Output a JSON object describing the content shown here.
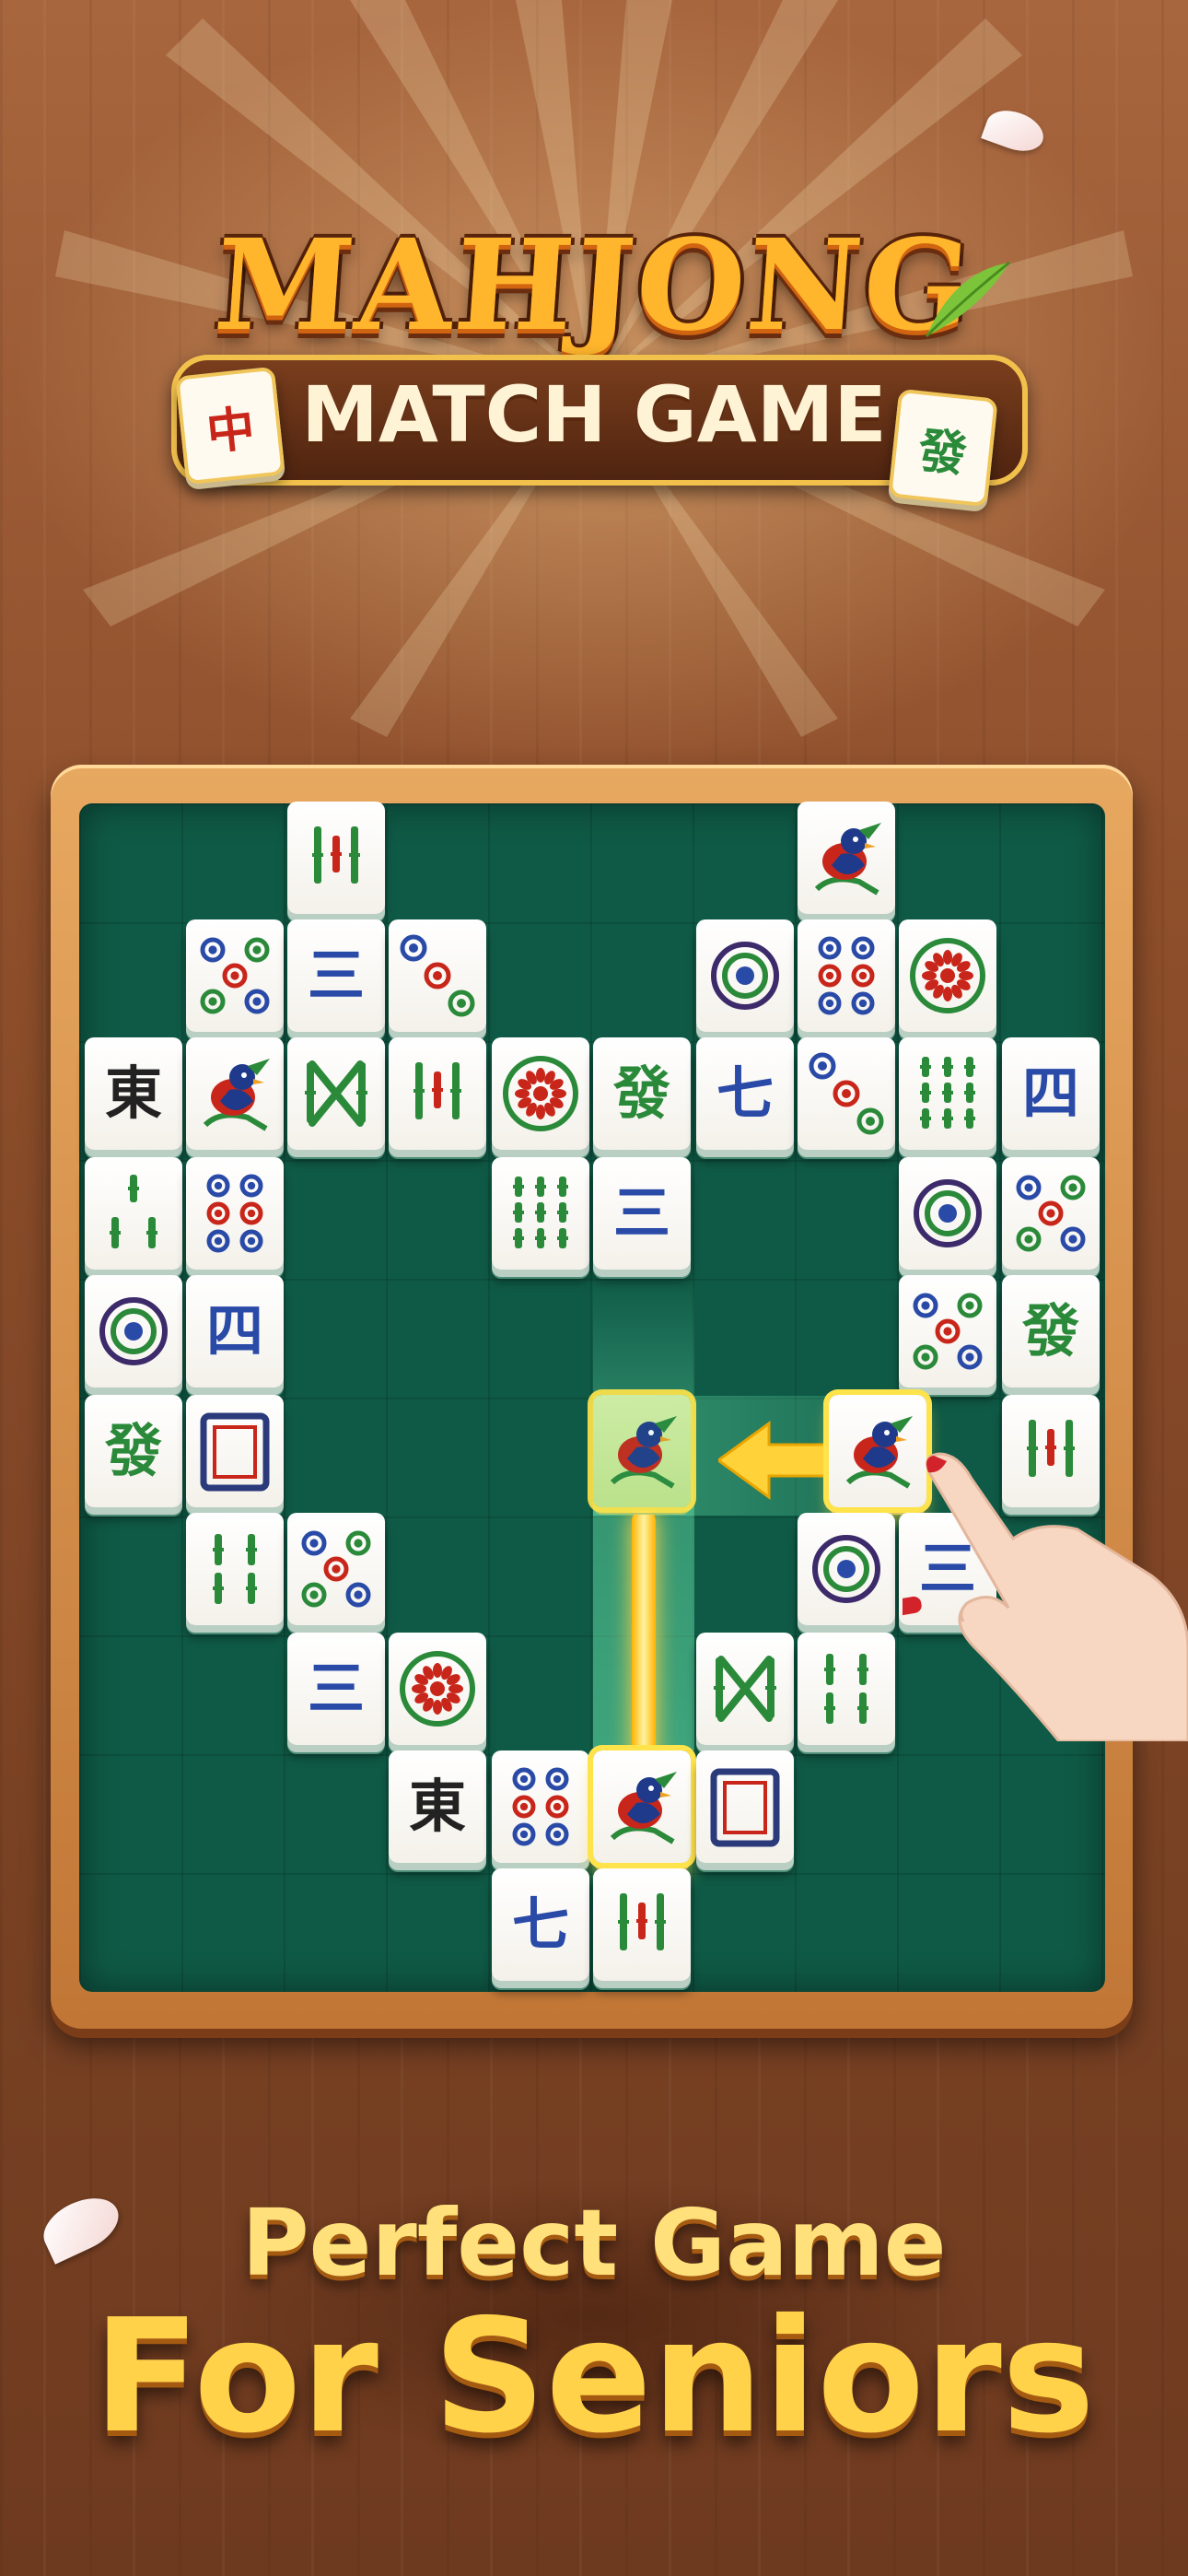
{
  "title": {
    "main": "MAHJONG",
    "sub": "MATCH GAME",
    "left_tile": "中",
    "right_tile": "發"
  },
  "colors": {
    "wood": "#8e4f2b",
    "felt": "#0f5a46",
    "frame": "#d68a45",
    "highlight": "#ffe34a",
    "tagline": "#ffd24a"
  },
  "tiles": [
    {
      "id": "t1",
      "kind": "bamboo3r"
    },
    {
      "id": "t2",
      "kind": "bird"
    },
    {
      "id": "t3",
      "kind": "circles5"
    },
    {
      "id": "t4",
      "kind": "char",
      "glyph": "三",
      "color": "blue"
    },
    {
      "id": "t5",
      "kind": "circles3"
    },
    {
      "id": "t6",
      "kind": "circle1"
    },
    {
      "id": "t7",
      "kind": "circles6"
    },
    {
      "id": "t8",
      "kind": "flower"
    },
    {
      "id": "t9",
      "kind": "char",
      "glyph": "東",
      "color": "black"
    },
    {
      "id": "t10",
      "kind": "bird"
    },
    {
      "id": "t11",
      "kind": "bamboo8"
    },
    {
      "id": "t12",
      "kind": "bamboo3r"
    },
    {
      "id": "t13",
      "kind": "flower"
    },
    {
      "id": "t14",
      "kind": "char",
      "glyph": "發",
      "color": "green"
    },
    {
      "id": "t15",
      "kind": "char",
      "glyph": "七",
      "color": "blue"
    },
    {
      "id": "t16",
      "kind": "circles3"
    },
    {
      "id": "t17",
      "kind": "bamboo9"
    },
    {
      "id": "t18",
      "kind": "char",
      "glyph": "四",
      "color": "blue"
    },
    {
      "id": "t19",
      "kind": "bamboo5"
    },
    {
      "id": "t20",
      "kind": "circles6"
    },
    {
      "id": "t21",
      "kind": "bamboo9"
    },
    {
      "id": "t22",
      "kind": "char",
      "glyph": "三",
      "color": "blue"
    },
    {
      "id": "t23",
      "kind": "circle1"
    },
    {
      "id": "t24",
      "kind": "circles5"
    },
    {
      "id": "t25",
      "kind": "circle1"
    },
    {
      "id": "t26",
      "kind": "char",
      "glyph": "四",
      "color": "blue"
    },
    {
      "id": "t27",
      "kind": "circles5"
    },
    {
      "id": "t28",
      "kind": "char",
      "glyph": "發",
      "color": "green"
    },
    {
      "id": "t29",
      "kind": "char",
      "glyph": "發",
      "color": "green"
    },
    {
      "id": "t30",
      "kind": "frame"
    },
    {
      "id": "t31",
      "kind": "bird",
      "state": "matched"
    },
    {
      "id": "t32",
      "kind": "bird",
      "state": "selected"
    },
    {
      "id": "t33",
      "kind": "bamboo3r"
    },
    {
      "id": "t34",
      "kind": "bamboo4"
    },
    {
      "id": "t35",
      "kind": "circles5"
    },
    {
      "id": "t36",
      "kind": "circle1"
    },
    {
      "id": "t37",
      "kind": "char",
      "glyph": "三",
      "color": "blue"
    },
    {
      "id": "t38",
      "kind": "char",
      "glyph": "三",
      "color": "blue"
    },
    {
      "id": "t39",
      "kind": "flower"
    },
    {
      "id": "t40",
      "kind": "bamboo8"
    },
    {
      "id": "t41",
      "kind": "bamboo4"
    },
    {
      "id": "t42",
      "kind": "char",
      "glyph": "東",
      "color": "black"
    },
    {
      "id": "t43",
      "kind": "circles6"
    },
    {
      "id": "t44",
      "kind": "bird",
      "state": "selected"
    },
    {
      "id": "t45",
      "kind": "frame"
    },
    {
      "id": "t46",
      "kind": "char",
      "glyph": "七",
      "color": "blue"
    },
    {
      "id": "t47",
      "kind": "bamboo3r"
    }
  ],
  "tagline": {
    "line1": "Perfect Game",
    "line2": "For Seniors"
  }
}
